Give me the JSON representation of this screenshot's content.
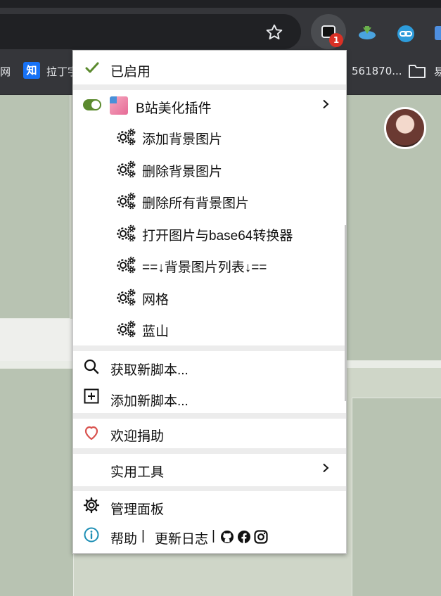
{
  "browser": {
    "extension_badge": "1",
    "bookmarks": {
      "left_fragment": "网",
      "zhihu_icon_glyph": "知",
      "lagou_label": "拉丁字",
      "number_label": "561870...",
      "folder_label": "易"
    }
  },
  "menu": {
    "enabled_label": "已启用",
    "plugin": {
      "name": "B站美化插件",
      "commands": [
        "添加背景图片",
        "删除背景图片",
        "删除所有背景图片",
        "打开图片与base64转换器",
        "==↓背景图片列表↓==",
        "网格",
        "蓝山"
      ]
    },
    "get_scripts_label": "获取新脚本...",
    "add_script_label": "添加新脚本...",
    "donate_label": "欢迎捐助",
    "utilities_label": "实用工具",
    "dashboard_label": "管理面板",
    "footer": {
      "help_label": "帮助",
      "divider1": "|",
      "changelog_label": "更新日志",
      "divider2": "|"
    }
  },
  "colors": {
    "toggle_on": "#5b8a2e",
    "check": "#5b8a2e",
    "heart": "#d9534f",
    "info": "#1e8fb5",
    "badge": "#d93025"
  },
  "icons": {
    "enabled": "check-icon",
    "toggle": "toggle-icon",
    "command": "gear-icon",
    "submenu": "chevron-right-icon",
    "get_scripts": "search-icon",
    "add_script": "plus-box-icon",
    "donate": "heart-icon",
    "dashboard": "cog-icon",
    "help": "info-icon",
    "social": [
      "github-icon",
      "facebook-icon",
      "instagram-icon"
    ]
  }
}
